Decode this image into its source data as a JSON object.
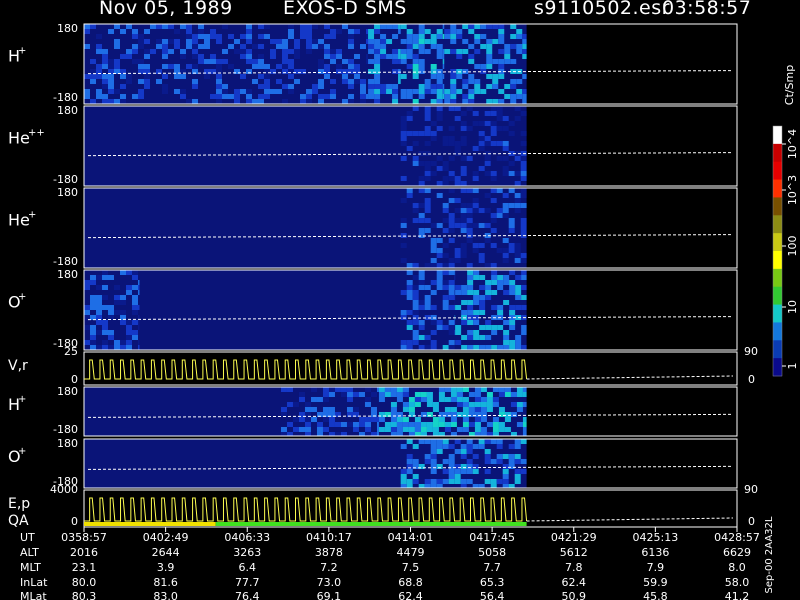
{
  "header": {
    "date": "Nov 05, 1989",
    "instrument": "EXOS-D SMS",
    "file": "s9110502.esr",
    "time": "03:58:57"
  },
  "colorbar": {
    "unit_label": "Ct/Smp",
    "ticks": [
      "10^4",
      "10^3",
      "100",
      "10",
      "1"
    ]
  },
  "side_label": "Sep-00 2AA32L",
  "chart_data": {
    "type": "heatmap",
    "time_range": [
      "03:58:57",
      "04:28:57"
    ],
    "panels": [
      {
        "name": "H+",
        "label": "H",
        "sup": "+",
        "ymin_label": "-180",
        "ymax_label": "180",
        "data_end": "04:19:17",
        "bands": [
          {
            "start": "03:58:57",
            "end": "04:12:00",
            "level": 1.2
          },
          {
            "start": "04:12:00",
            "end": "04:13:30",
            "level": 1.8
          },
          {
            "start": "04:13:30",
            "end": "04:15:30",
            "level": 2.6
          },
          {
            "start": "04:15:30",
            "end": "04:19:17",
            "level": 2.2
          }
        ]
      },
      {
        "name": "He++",
        "label": "He",
        "sup": "++",
        "ymin_label": "-180",
        "ymax_label": "180",
        "data_end": "04:19:17",
        "bands": [
          {
            "start": "04:13:30",
            "end": "04:19:17",
            "level": 0.4
          }
        ]
      },
      {
        "name": "He+",
        "label": "He",
        "sup": "+",
        "ymin_label": "-180",
        "ymax_label": "180",
        "data_end": "04:19:17",
        "bands": [
          {
            "start": "04:13:30",
            "end": "04:19:17",
            "level": 0.8
          }
        ]
      },
      {
        "name": "O+",
        "label": "O",
        "sup": "+",
        "ymin_label": "-180",
        "ymax_label": "180",
        "data_end": "04:19:17",
        "bands": [
          {
            "start": "03:58:57",
            "end": "04:01:30",
            "level": 1.2
          },
          {
            "start": "04:13:30",
            "end": "04:16:00",
            "level": 1.4
          },
          {
            "start": "04:16:00",
            "end": "04:19:17",
            "level": 2.3
          }
        ]
      },
      {
        "name": "H+ (2)",
        "label": "H",
        "sup": "+",
        "ymin_label": "-180",
        "ymax_label": "180",
        "data_end": "04:19:17",
        "bands": [
          {
            "start": "04:08:00",
            "end": "04:12:30",
            "level": 1.0
          },
          {
            "start": "04:12:30",
            "end": "04:19:17",
            "level": 2.5
          }
        ]
      },
      {
        "name": "O+ (2)",
        "label": "O",
        "sup": "+",
        "ymin_label": "-180",
        "ymax_label": "180",
        "data_end": "04:19:17",
        "bands": [
          {
            "start": "04:13:30",
            "end": "04:19:17",
            "level": 1.8
          }
        ]
      }
    ],
    "line_panels": [
      {
        "name": "V,r",
        "label": "V,r",
        "top_label": "25",
        "zero_label": "0",
        "right_label": "90",
        "right_zero": "0",
        "step_count": 43,
        "data_end": "04:19:17"
      },
      {
        "name": "E,p QA",
        "label": "E,p",
        "label2": "QA",
        "top_label": "4000",
        "zero_label": "0",
        "right_label": "90",
        "right_zero": "0",
        "step_count": 43,
        "data_end": "04:19:17"
      }
    ],
    "qa_bar": [
      {
        "start": "03:58:57",
        "end": "04:05:00",
        "color": "#f0e000"
      },
      {
        "start": "04:05:00",
        "end": "04:19:17",
        "color": "#40e020"
      }
    ],
    "x_axis": {
      "rows": [
        {
          "name": "UT",
          "values": [
            "0358:57",
            "0402:49",
            "0406:33",
            "0410:17",
            "0414:01",
            "0417:45",
            "0421:29",
            "0425:13",
            "0428:57"
          ]
        },
        {
          "name": "ALT",
          "values": [
            "2016",
            "2644",
            "3263",
            "3878",
            "4479",
            "5058",
            "5612",
            "6136",
            "6629"
          ]
        },
        {
          "name": "MLT",
          "values": [
            "23.1",
            "3.9",
            "6.4",
            "7.2",
            "7.5",
            "7.7",
            "7.8",
            "7.9",
            "8.0"
          ]
        },
        {
          "name": "InLat",
          "values": [
            "80.0",
            "81.6",
            "77.7",
            "73.0",
            "68.8",
            "65.3",
            "62.4",
            "59.9",
            "58.0"
          ]
        },
        {
          "name": "MLat",
          "values": [
            "80.3",
            "83.0",
            "76.4",
            "69.1",
            "62.4",
            "56.4",
            "50.9",
            "45.8",
            "41.2"
          ]
        }
      ]
    }
  }
}
